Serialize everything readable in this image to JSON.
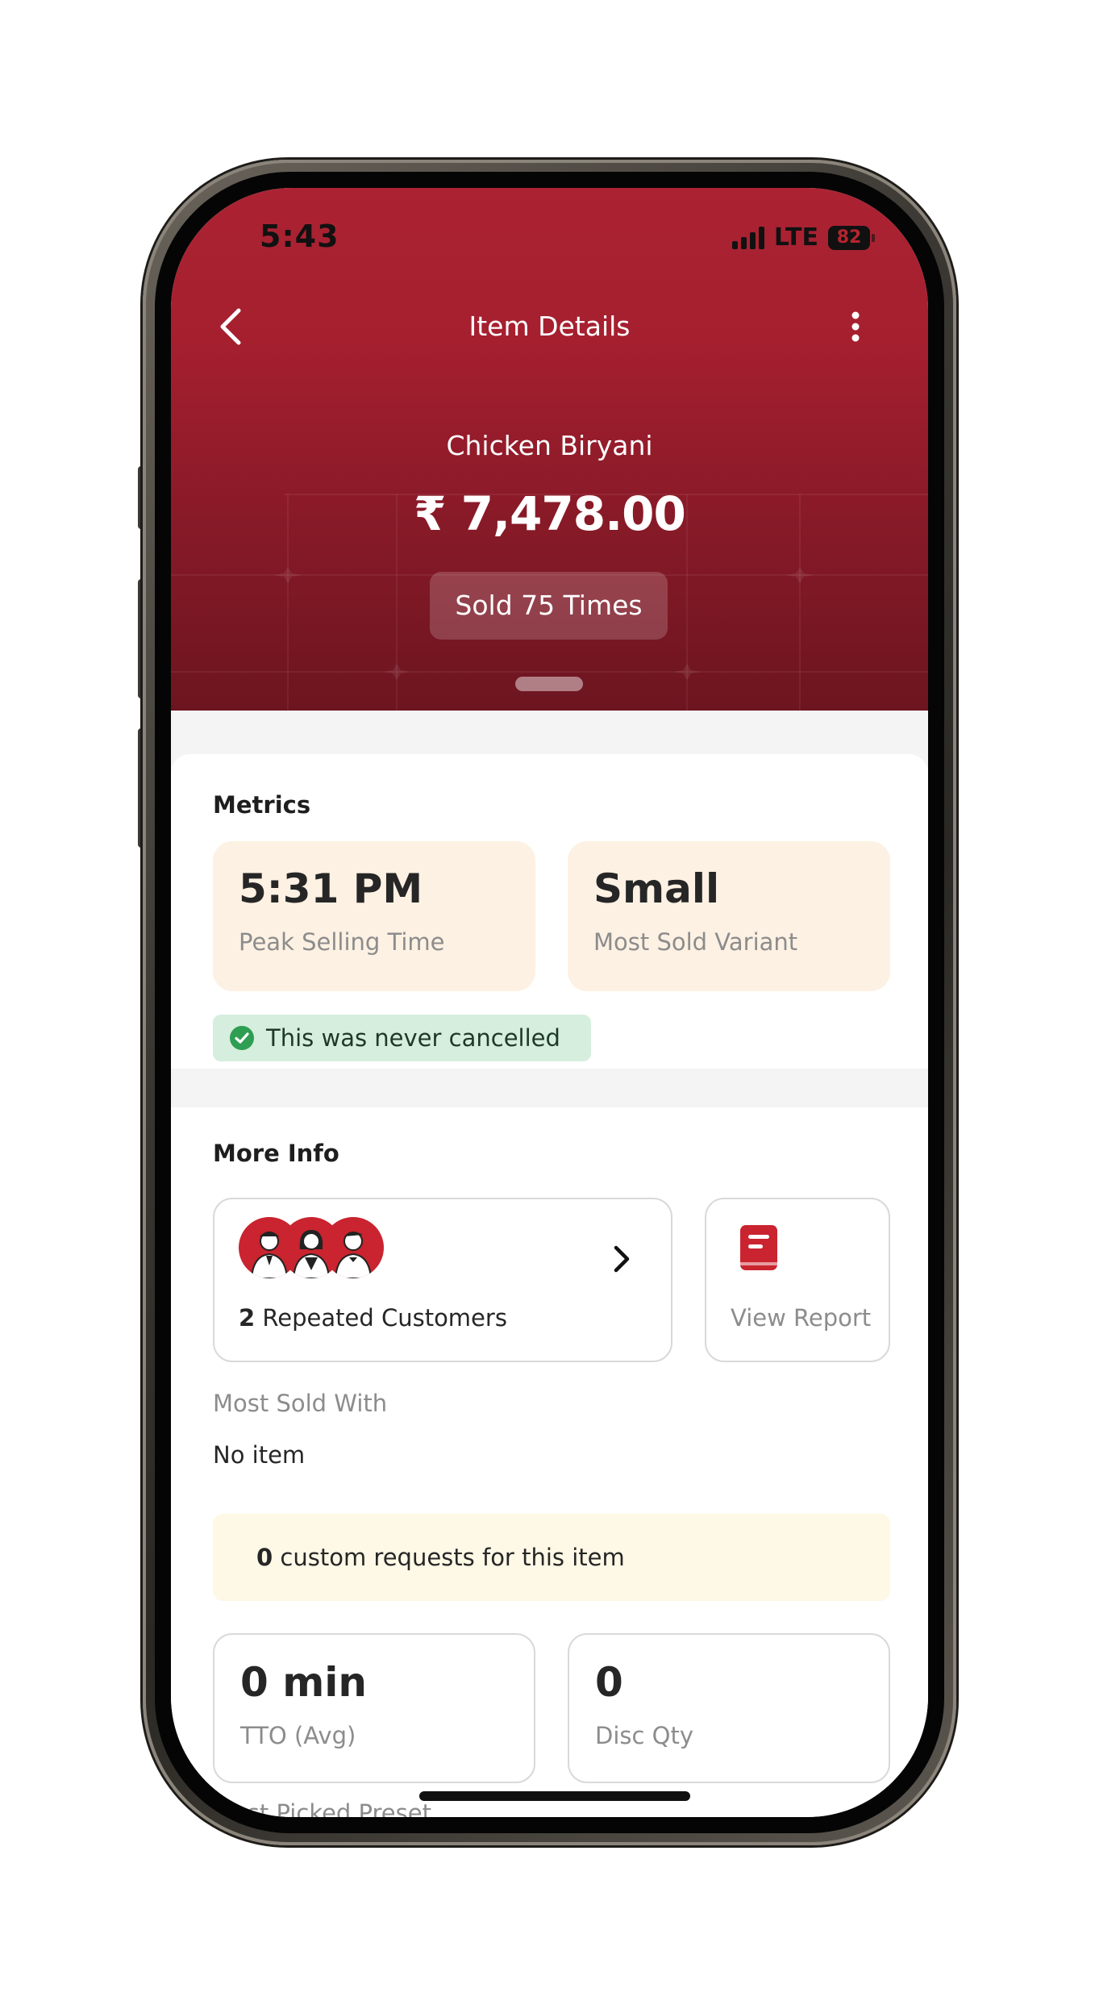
{
  "status_bar": {
    "time": "5:43",
    "network": "LTE",
    "battery": "82"
  },
  "nav": {
    "title": "Item Details"
  },
  "item": {
    "name": "Chicken Biryani",
    "amount": "₹ 7,478.00",
    "sold_label": "Sold 75 Times"
  },
  "metrics": {
    "title": "Metrics",
    "peak_time": {
      "value": "5:31 PM",
      "label": "Peak Selling Time"
    },
    "variant": {
      "value": "Small",
      "label": "Most Sold Variant"
    },
    "cancel_note": "This was never cancelled"
  },
  "more_info": {
    "title": "More Info",
    "repeat_count": "2",
    "repeat_label": "Repeated Customers",
    "report_label": "View Report",
    "most_sold_with_label": "Most Sold With",
    "most_sold_with_value": "No item",
    "custom_count": "0",
    "custom_label": "custom requests for this item",
    "tto": {
      "value": "0 min",
      "label": "TTO (Avg)"
    },
    "disc": {
      "value": "0",
      "label": "Disc Qty"
    },
    "preset_label": "Most Picked Preset"
  },
  "colors": {
    "brand_red": "#ab2333",
    "peach": "#fdf1e3",
    "success_bg": "#d5eedd",
    "banner_yellow": "#fef8e6"
  }
}
